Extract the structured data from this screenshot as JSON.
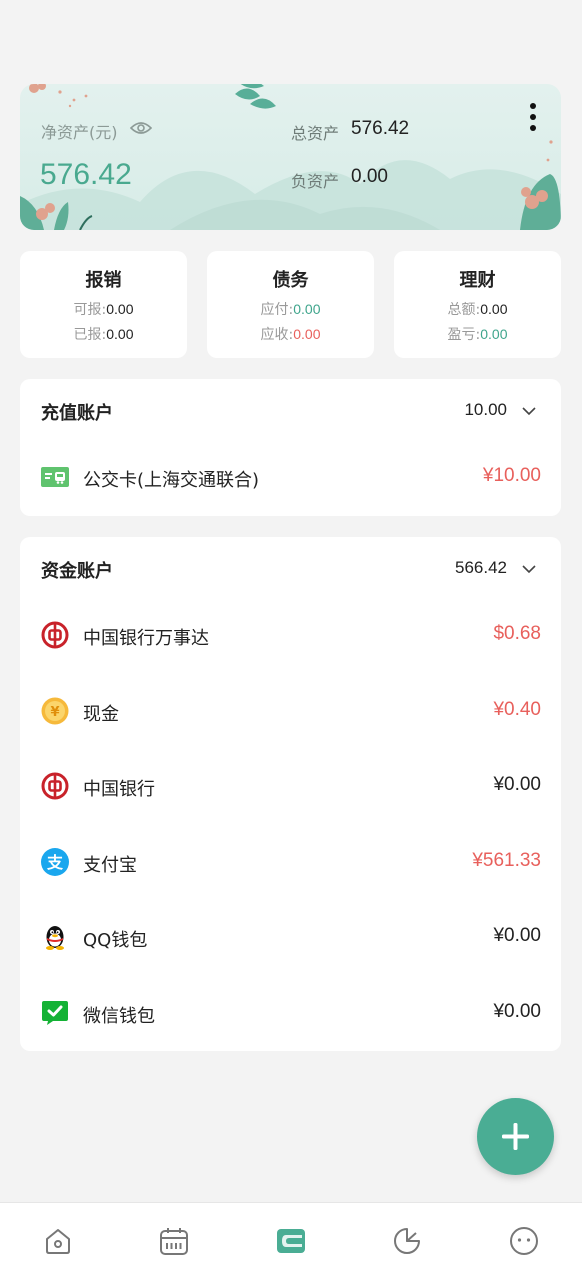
{
  "header": {
    "net_assets_label": "净资产(元)",
    "net_assets_value": "576.42",
    "total_assets_label": "总资产",
    "total_assets_value": "576.42",
    "liabilities_label": "负资产",
    "liabilities_value": "0.00"
  },
  "summary_cards": {
    "reimburse": {
      "title": "报销",
      "row1_label": "可报:",
      "row1_value": "0.00",
      "row2_label": "已报:",
      "row2_value": "0.00"
    },
    "debt": {
      "title": "债务",
      "row1_label": "应付:",
      "row1_value": "0.00",
      "row2_label": "应收:",
      "row2_value": "0.00"
    },
    "finance": {
      "title": "理财",
      "row1_label": "总额:",
      "row1_value": "0.00",
      "row2_label": "盈亏:",
      "row2_value": "0.00"
    }
  },
  "recharge_section": {
    "title": "充值账户",
    "total": "10.00",
    "accounts": [
      {
        "name": "公交卡(上海交通联合)",
        "amount": "¥10.00",
        "icon": "bus-card-icon"
      }
    ]
  },
  "fund_section": {
    "title": "资金账户",
    "total": "566.42",
    "accounts": [
      {
        "name": "中国银行万事达",
        "amount": "$0.68",
        "icon": "boc-icon"
      },
      {
        "name": "现金",
        "amount": "¥0.40",
        "icon": "cash-coin-icon"
      },
      {
        "name": "中国银行",
        "amount": "¥0.00",
        "icon": "boc-icon"
      },
      {
        "name": "支付宝",
        "amount": "¥561.33",
        "icon": "alipay-icon"
      },
      {
        "name": "QQ钱包",
        "amount": "¥0.00",
        "icon": "qq-icon"
      },
      {
        "name": "微信钱包",
        "amount": "¥0.00",
        "icon": "wechat-icon"
      }
    ]
  },
  "colors": {
    "accent": "#4aad94",
    "positive_green": "#3fa58c",
    "negative_red": "#e8605c",
    "background": "#f3f3f3"
  },
  "bottom_nav": [
    "home-icon",
    "calendar-icon",
    "wallet-icon",
    "pie-chart-icon",
    "profile-icon"
  ],
  "active_tab": "wallet-icon"
}
